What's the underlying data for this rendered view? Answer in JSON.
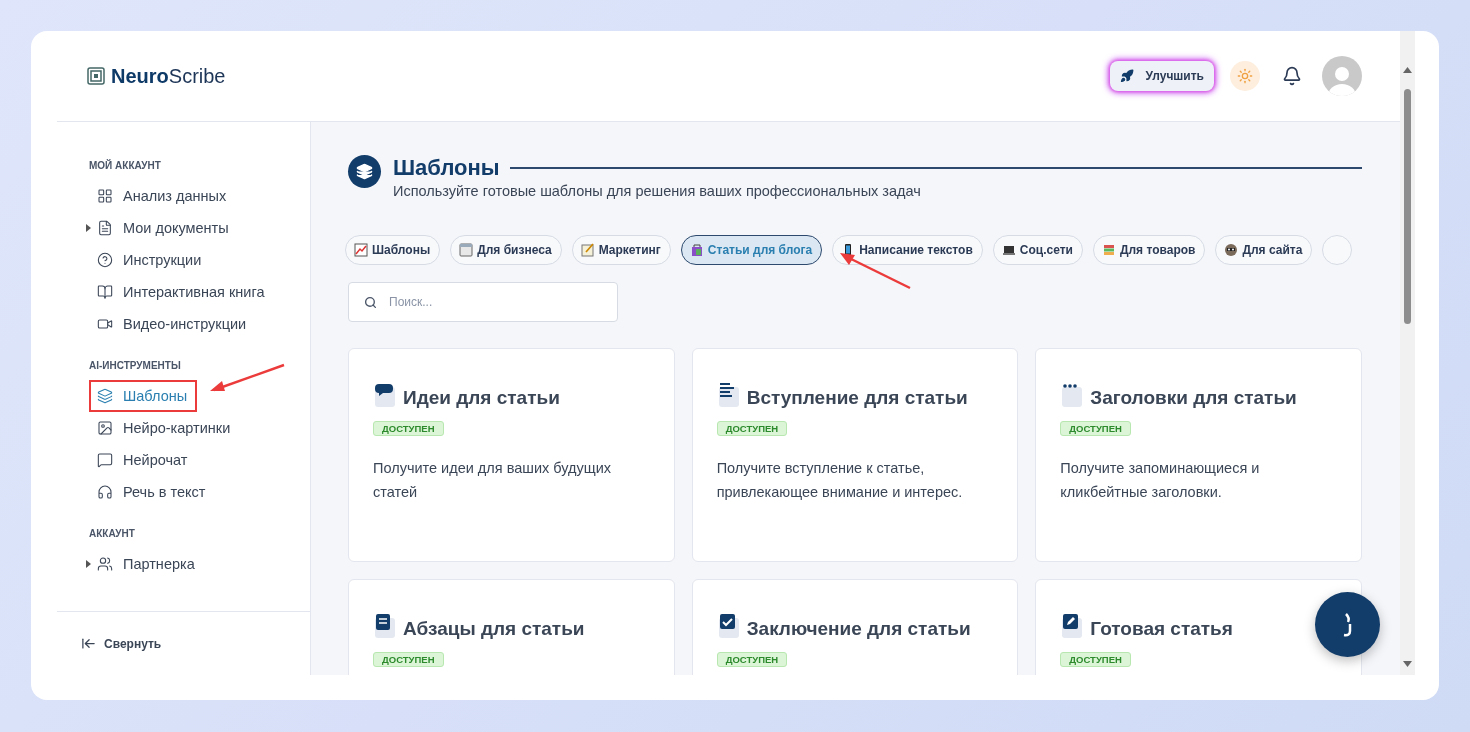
{
  "header": {
    "logo": {
      "bold": "Neuro",
      "light": "Scribe"
    },
    "upgrade_button": "Улучшить"
  },
  "sidebar": {
    "sections": [
      {
        "title": "МОЙ АККАУНТ",
        "items": [
          {
            "label": "Анализ данных",
            "kind": "link",
            "selected": false
          },
          {
            "label": "Мои документы",
            "kind": "group",
            "expanded": false,
            "selected": false
          },
          {
            "label": "Инструкции",
            "kind": "link",
            "selected": false
          },
          {
            "label": "Интерактивная книга",
            "kind": "link",
            "selected": false
          },
          {
            "label": "Видео-инструкции",
            "kind": "link",
            "selected": false
          }
        ]
      },
      {
        "title": "AI-ИНСТРУМЕНТЫ",
        "items": [
          {
            "label": "Шаблоны",
            "kind": "link",
            "selected": true,
            "annotated": true
          },
          {
            "label": "Нейро-картинки",
            "kind": "link",
            "selected": false
          },
          {
            "label": "Нейрочат",
            "kind": "link",
            "selected": false
          },
          {
            "label": "Речь в текст",
            "kind": "link",
            "selected": false
          }
        ]
      },
      {
        "title": "АККАУНТ",
        "items": [
          {
            "label": "Партнерка",
            "kind": "group",
            "expanded": false,
            "selected": false
          }
        ]
      }
    ],
    "collapse": "Свернуть"
  },
  "page": {
    "title": "Шаблоны",
    "subtitle": "Используйте готовые шаблоны для решения ваших профессиональных задач",
    "categories": [
      {
        "label": "Шаблоны",
        "selected": false
      },
      {
        "label": "Для бизнеса",
        "selected": false
      },
      {
        "label": "Маркетинг",
        "selected": false
      },
      {
        "label": "Статьи для блога",
        "selected": true
      },
      {
        "label": "Написание текстов",
        "selected": false
      },
      {
        "label": "Соц.сети",
        "selected": false
      },
      {
        "label": "Для товаров",
        "selected": false
      },
      {
        "label": "Для сайта",
        "selected": false
      }
    ],
    "search": {
      "placeholder": "Поиск..."
    },
    "cards": [
      {
        "title": "Идеи для статьи",
        "badge": "ДОСТУПЕН",
        "description": "Получите идеи для ваших будущих статей"
      },
      {
        "title": "Вступление для статьи",
        "badge": "ДОСТУПЕН",
        "description": "Получите вступление к статье, привлекающее внимание и интерес."
      },
      {
        "title": "Заголовки для статьи",
        "badge": "ДОСТУПЕН",
        "description": "Получите запоминающиеся и кликбейтные заголовки."
      },
      {
        "title": "Абзацы для статьи",
        "badge": "ДОСТУПЕН"
      },
      {
        "title": "Заключение для статьи",
        "badge": "ДОСТУПЕН"
      },
      {
        "title": "Готовая статья",
        "badge": "ДОСТУПЕН"
      }
    ]
  }
}
